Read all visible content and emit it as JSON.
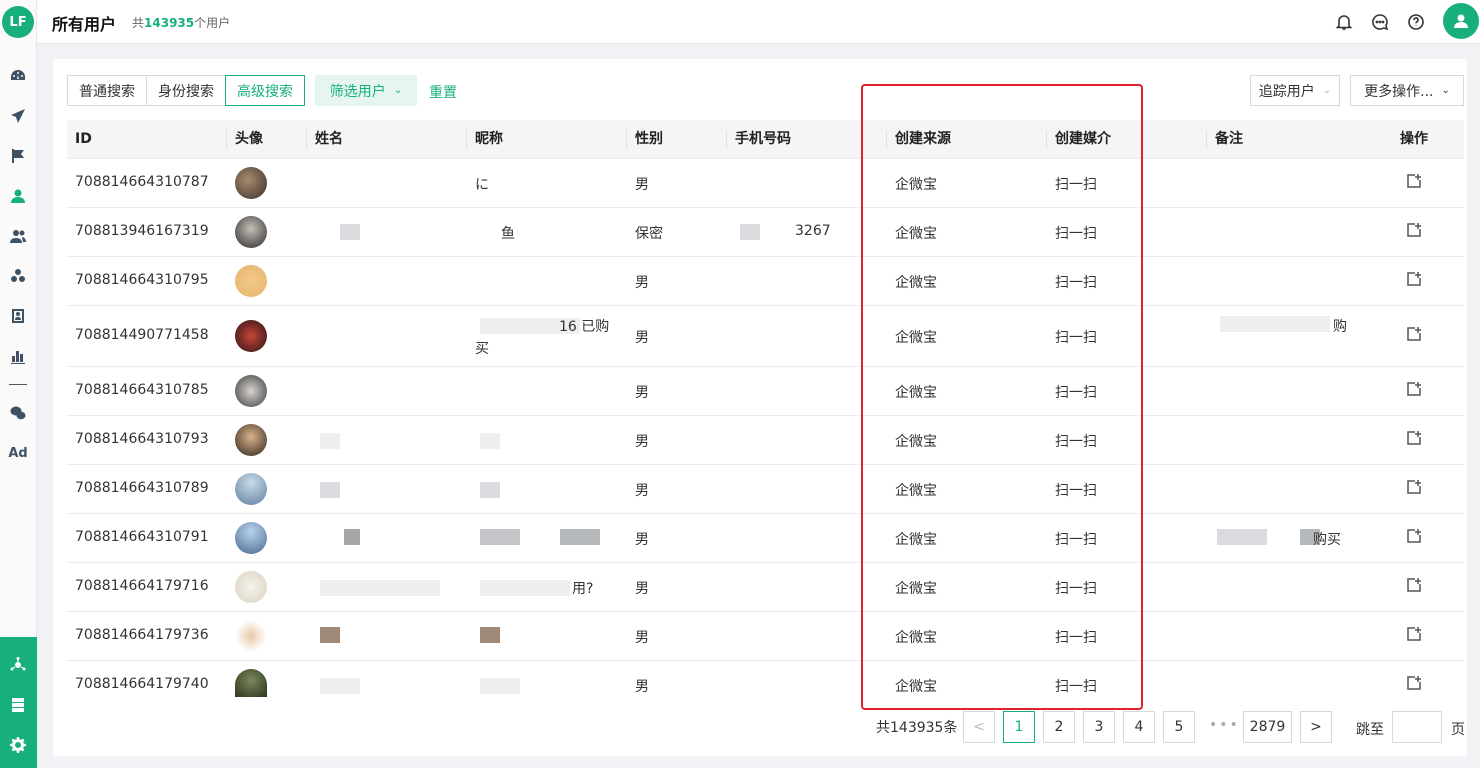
{
  "header": {
    "logo": "LF",
    "title": "所有用户",
    "count_prefix": "共",
    "count": "143935",
    "count_suffix": "个用户",
    "icons": [
      "bell-icon",
      "message-icon",
      "help-icon",
      "user-avatar-icon"
    ]
  },
  "sidebar": {
    "icons": [
      "dashboard-icon",
      "send-icon",
      "flag-icon",
      "user-icon",
      "users-icon",
      "groups-icon",
      "contacts-icon",
      "chart-icon",
      "wechat-icon",
      "ad-icon"
    ],
    "ad_label": "Ad",
    "bottom_icons": [
      "apps-icon",
      "server-icon",
      "settings-icon"
    ]
  },
  "toolbar": {
    "search_tabs": [
      "普通搜索",
      "身份搜索",
      "高级搜索"
    ],
    "active_tab": "高级搜索",
    "filter_label": "筛选用户",
    "reset_label": "重置",
    "track_label": "追踪用户",
    "more_label": "更多操作..."
  },
  "table": {
    "columns": [
      "ID",
      "头像",
      "姓名",
      "昵称",
      "性别",
      "手机号码",
      "创建来源",
      "创建媒介",
      "备注",
      "操作"
    ],
    "rows": [
      {
        "id": "708814664310787",
        "name": "",
        "nickname": "に",
        "gender": "男",
        "phone": "",
        "source": "企微宝",
        "medium": "扫一扫",
        "remark": ""
      },
      {
        "id": "708813946167319",
        "name": "",
        "nickname": "鱼",
        "gender": "保密",
        "phone": "3267",
        "source": "企微宝",
        "medium": "扫一扫",
        "remark": ""
      },
      {
        "id": "708814664310795",
        "name": "",
        "nickname": "",
        "gender": "男",
        "phone": "",
        "source": "企微宝",
        "medium": "扫一扫",
        "remark": ""
      },
      {
        "id": "708814490771458",
        "name": "",
        "nickname": "16 已购",
        "nickname2": "买",
        "gender": "男",
        "phone": "",
        "source": "企微宝",
        "medium": "扫一扫",
        "remark": "购"
      },
      {
        "id": "708814664310785",
        "name": "",
        "nickname": "",
        "gender": "男",
        "phone": "",
        "source": "企微宝",
        "medium": "扫一扫",
        "remark": ""
      },
      {
        "id": "708814664310793",
        "name": "",
        "nickname": "",
        "gender": "男",
        "phone": "",
        "source": "企微宝",
        "medium": "扫一扫",
        "remark": ""
      },
      {
        "id": "708814664310789",
        "name": "",
        "nickname": "",
        "gender": "男",
        "phone": "",
        "source": "企微宝",
        "medium": "扫一扫",
        "remark": ""
      },
      {
        "id": "708814664310791",
        "name": "",
        "nickname": "",
        "gender": "男",
        "phone": "",
        "source": "企微宝",
        "medium": "扫一扫",
        "remark": "购买"
      },
      {
        "id": "708814664179716",
        "name": "",
        "nickname": "用?",
        "gender": "男",
        "phone": "",
        "source": "企微宝",
        "medium": "扫一扫",
        "remark": ""
      },
      {
        "id": "708814664179736",
        "name": "",
        "nickname": "",
        "gender": "男",
        "phone": "",
        "source": "企微宝",
        "medium": "扫一扫",
        "remark": ""
      },
      {
        "id": "708814664179740",
        "name": "",
        "nickname": "",
        "gender": "男",
        "phone": "",
        "source": "企微宝",
        "medium": "扫一扫",
        "remark": ""
      }
    ]
  },
  "pagination": {
    "total": "共143935条",
    "pages": [
      "1",
      "2",
      "3",
      "4",
      "5"
    ],
    "current": "1",
    "last": "2879",
    "dots": "•••",
    "prev": "<",
    "next": ">",
    "jump_label": "跳至",
    "jump_unit": "页"
  },
  "colors": {
    "accent": "#17b07b",
    "highlight": "#e1222e"
  }
}
